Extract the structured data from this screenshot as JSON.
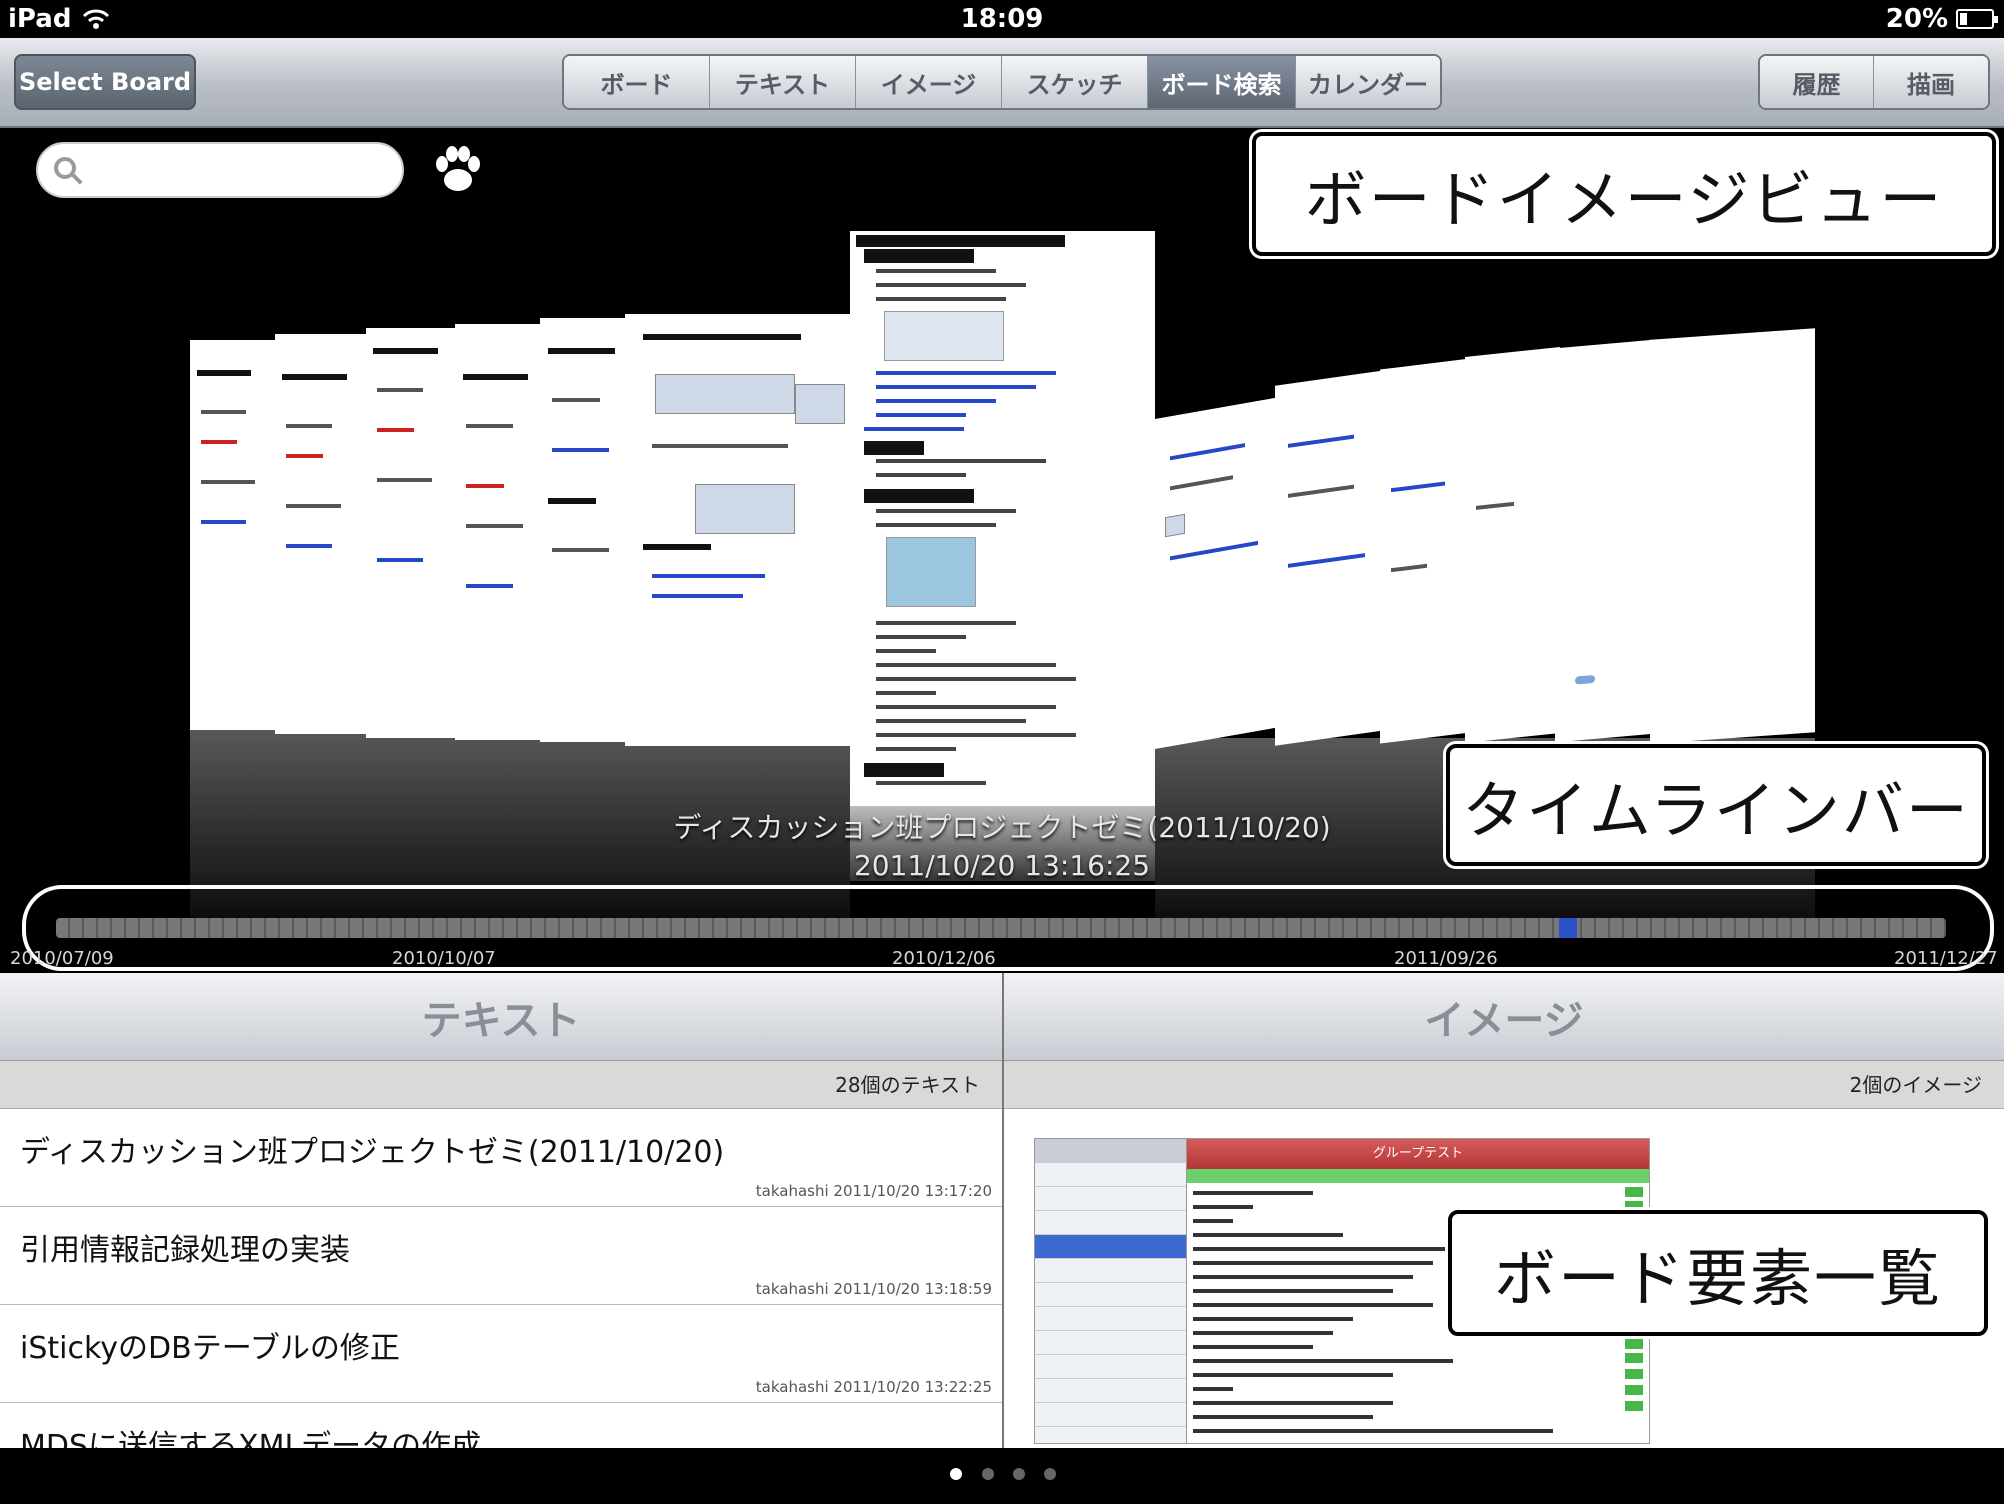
{
  "status": {
    "device": "iPad",
    "time": "18:09",
    "battery": "20%"
  },
  "toolbar": {
    "select_board": "Select Board",
    "tabs": [
      "ボード",
      "テキスト",
      "イメージ",
      "スケッチ",
      "ボード検索",
      "カレンダー"
    ],
    "active_tab": "ボード検索",
    "right_buttons": [
      "履歴",
      "描画"
    ]
  },
  "boardview": {
    "search_placeholder": "",
    "caption_title": "ディスカッション班プロジェクトゼミ(2011/10/20)",
    "caption_datetime": "2011/10/20 13:16:25",
    "timeline_dates": [
      "2010/07/09",
      "2010/10/07",
      "2010/12/06",
      "2011/09/26",
      "2011/12/27"
    ],
    "timeline_position": 0.8
  },
  "callouts": {
    "board_image_view": "ボードイメージビュー",
    "timeline_bar": "タイムラインバー",
    "board_elements": "ボード要素一覧"
  },
  "text_panel": {
    "header": "テキスト",
    "count": "28個のテキスト",
    "items": [
      {
        "title": "ディスカッション班プロジェクトゼミ(2011/10/20)",
        "meta": "takahashi 2011/10/20 13:17:20"
      },
      {
        "title": "引用情報記録処理の実装",
        "meta": "takahashi 2011/10/20 13:18:59"
      },
      {
        "title": "iStickyのDBテーブルの修正",
        "meta": "takahashi 2011/10/20 13:22:25"
      },
      {
        "title": "MDSに送信するXMLデータの作成",
        "meta": ""
      }
    ]
  },
  "image_panel": {
    "header": "イメージ",
    "count": "2個のイメージ",
    "thumb_title": "グループテスト"
  },
  "pager": {
    "pages": 4,
    "current": 0
  },
  "colors": {
    "accent": "#2d4fc7",
    "toolbar": "#b9bec6"
  }
}
